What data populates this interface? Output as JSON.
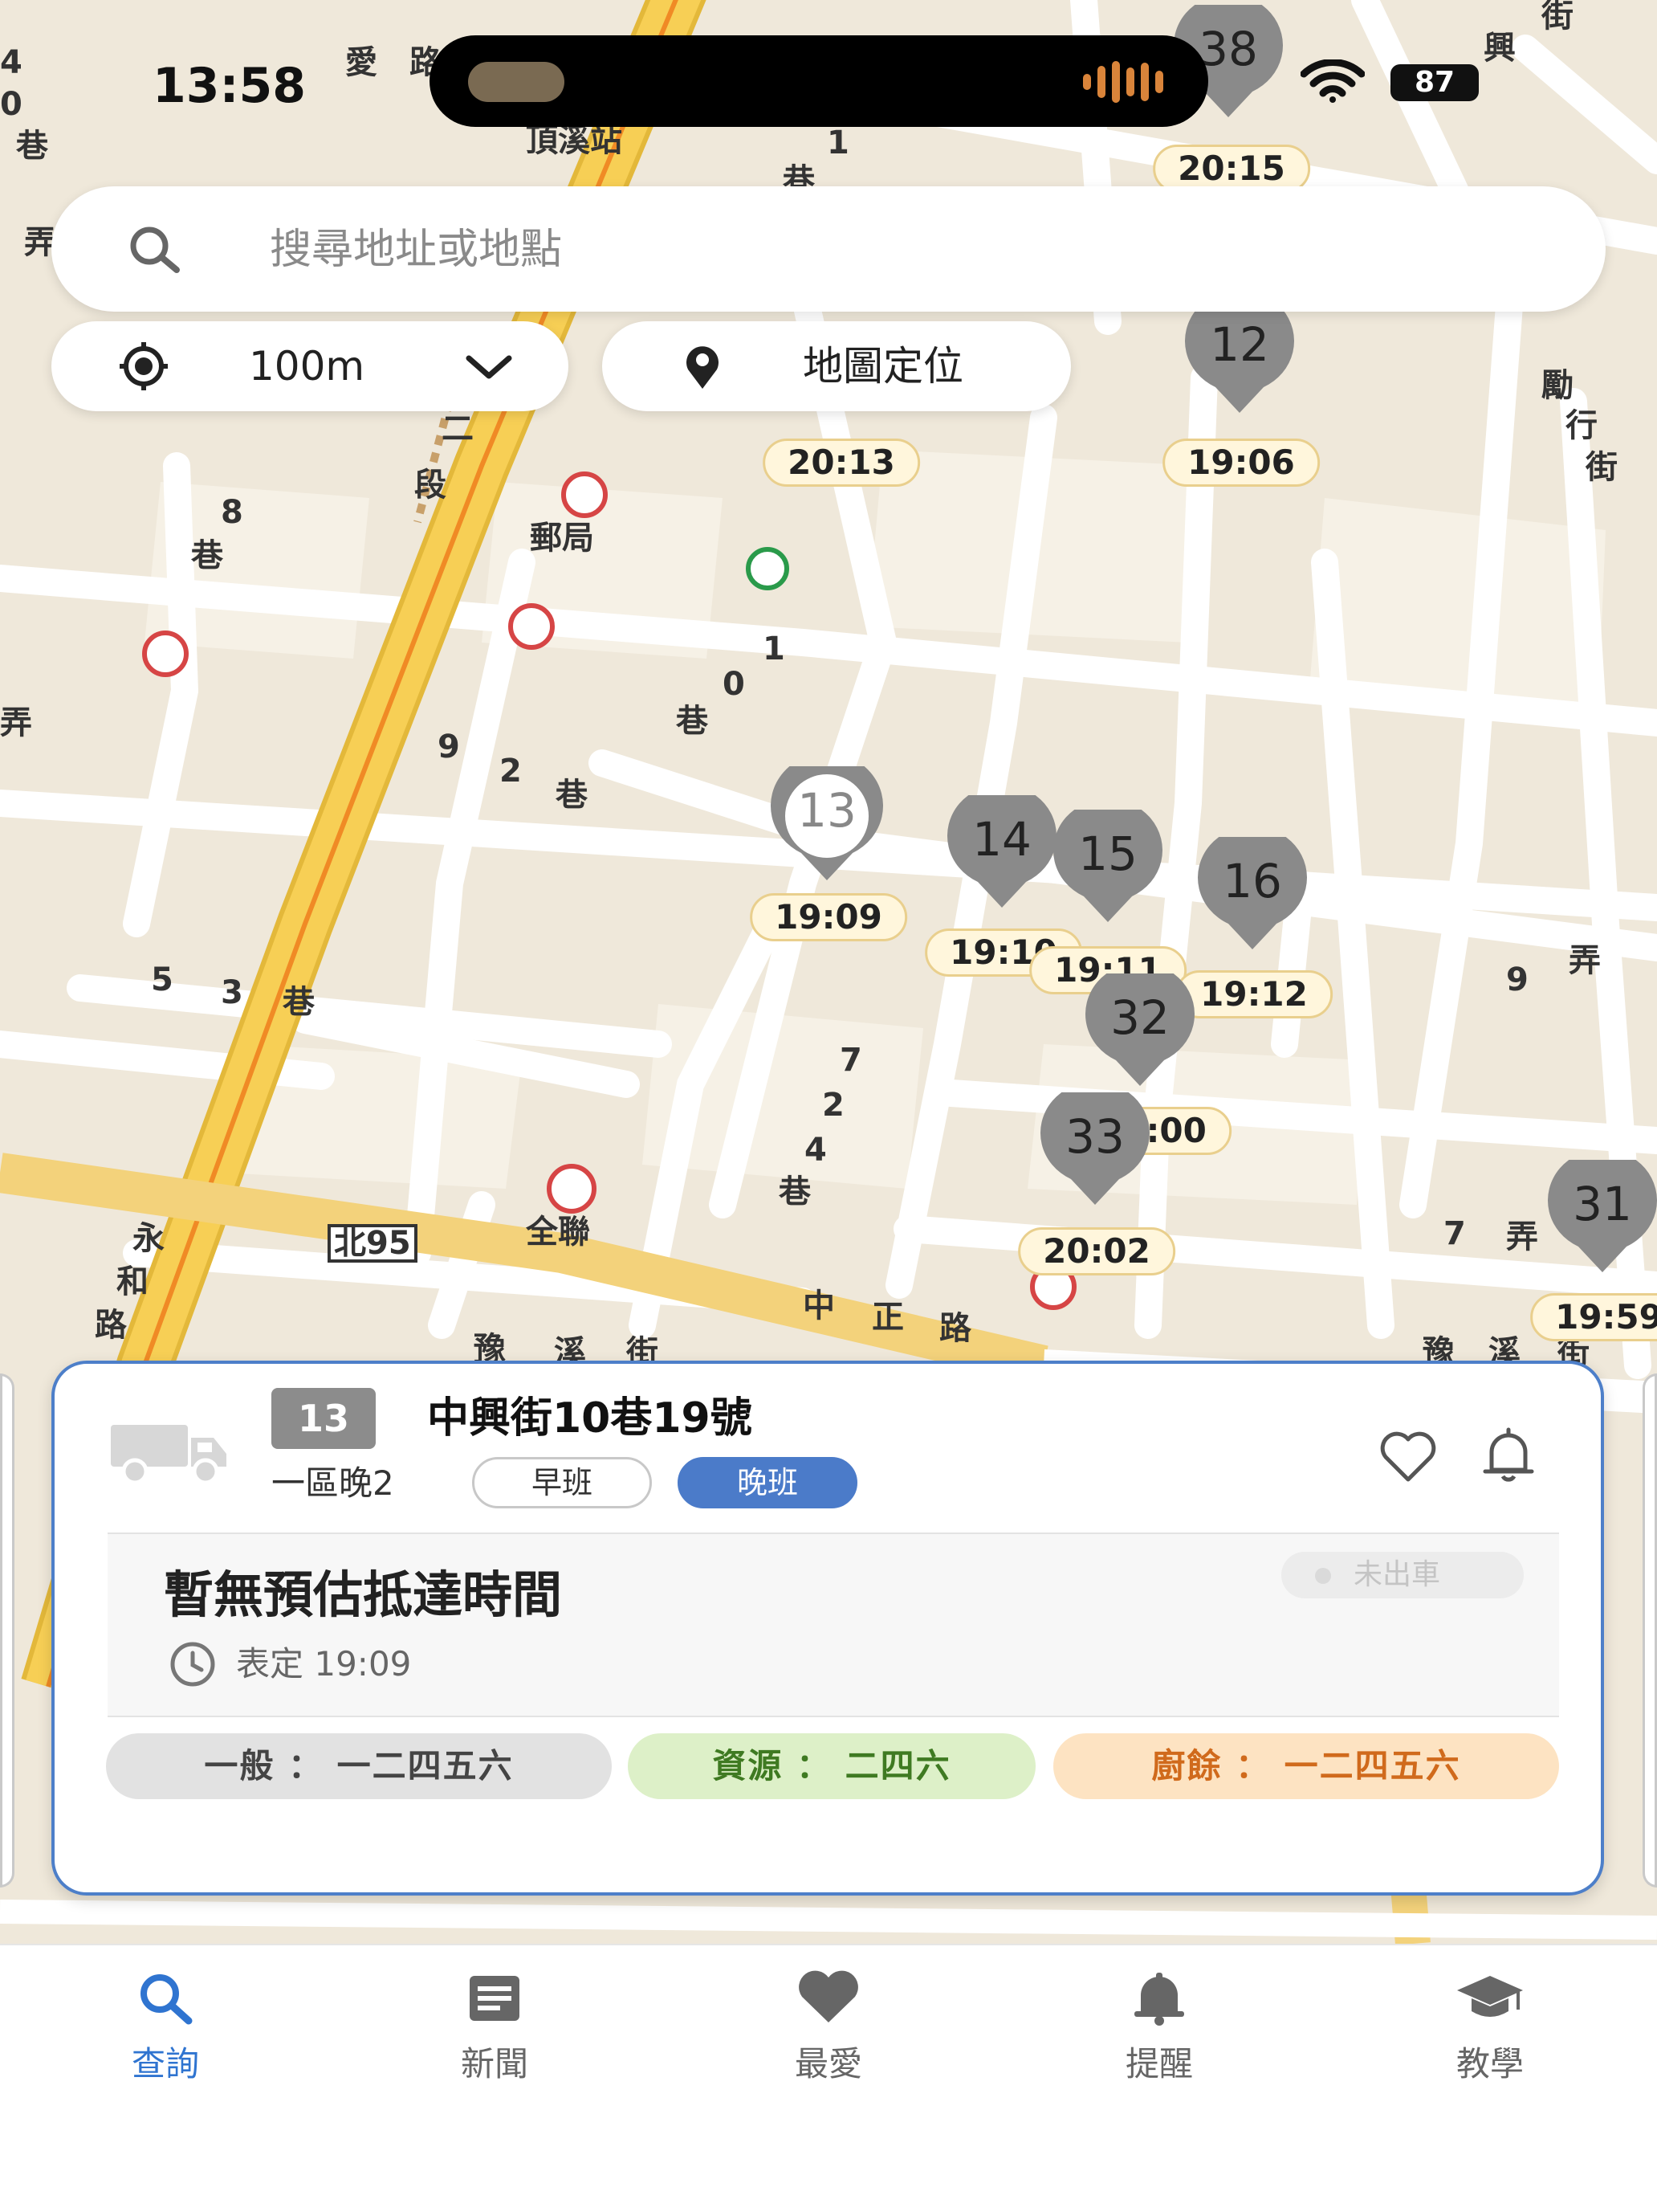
{
  "status_bar": {
    "time": "13:58",
    "battery": "87"
  },
  "search": {
    "placeholder": "搜尋地址或地點"
  },
  "controls": {
    "radius_label": "100m",
    "locate_label": "地圖定位"
  },
  "map_labels": [
    "愛",
    "路",
    "頂溪站",
    "1",
    "巷",
    "8",
    "巷",
    "段",
    "二",
    "郵局",
    "9",
    "2",
    "巷",
    "1",
    "0",
    "巷",
    "5",
    "3",
    "巷",
    "7",
    "2",
    "4",
    "巷",
    "全聯",
    "北95",
    "永",
    "和",
    "路",
    "中",
    "正",
    "路",
    "豫",
    "溪",
    "街",
    "豫",
    "溪",
    "街",
    "勵",
    "行",
    "街",
    "9",
    "弄",
    "7",
    "弄",
    "興",
    "街",
    "0",
    "巷",
    "弄",
    "弄",
    "4"
  ],
  "markers": [
    {
      "num": "38",
      "time": "20:15"
    },
    {
      "num": "12",
      "time": "19:06"
    },
    {
      "num": "",
      "time": "20:13"
    },
    {
      "num": "13",
      "time": "19:09"
    },
    {
      "num": "14",
      "time": "19:10"
    },
    {
      "num": "15",
      "time": "19:11"
    },
    {
      "num": "16",
      "time": "19:12"
    },
    {
      "num": "32",
      "time": "20:00"
    },
    {
      "num": "33",
      "time": "20:02"
    },
    {
      "num": "31",
      "time": "19:59"
    }
  ],
  "card": {
    "route_num": "13",
    "address": "中興街10巷19號",
    "area": "一區晚2",
    "shift_morning": "早班",
    "shift_evening": "晚班",
    "eta_title": "暫無預估抵達時間",
    "scheduled": "表定 19:09",
    "dispatch_status": "未出車",
    "waste_general": "一般 ： 一二四五六",
    "waste_recycle": "資源 ： 二四六",
    "waste_kitchen": "廚餘 ： 一二四五六"
  },
  "nav": [
    {
      "label": "查詢",
      "icon": "search-icon"
    },
    {
      "label": "新聞",
      "icon": "news-icon"
    },
    {
      "label": "最愛",
      "icon": "heart-icon"
    },
    {
      "label": "提醒",
      "icon": "bell-icon"
    },
    {
      "label": "教學",
      "icon": "graduation-cap-icon"
    }
  ],
  "colors": {
    "accent": "#2f74d0",
    "card_border": "#4d7fc9",
    "evening_shift": "#4b7bc9",
    "map_bg": "#efe8da",
    "road_major": "#f5c84a",
    "marker": "#8a8a8a"
  }
}
